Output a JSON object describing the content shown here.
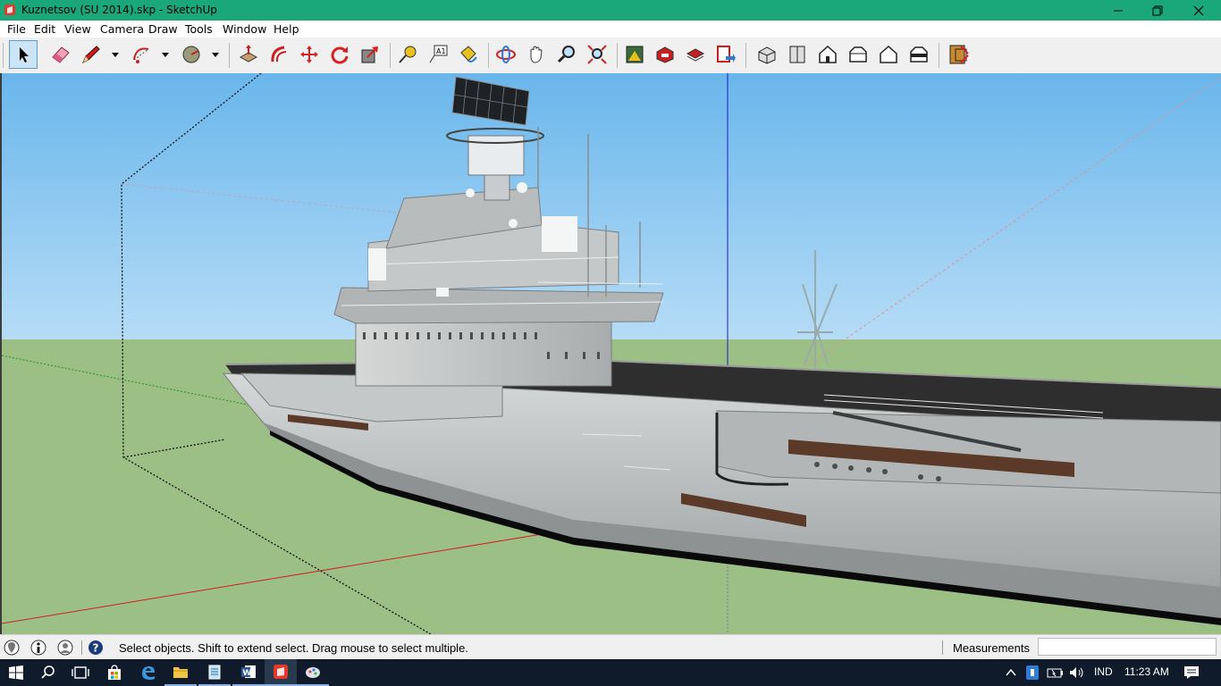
{
  "window": {
    "title": "Kuznetsov (SU 2014).skp - SketchUp",
    "icon": "sketchup-icon",
    "controls": [
      "minimize-icon",
      "restore-icon",
      "close-icon"
    ]
  },
  "menu": {
    "file": "File",
    "edit": "Edit",
    "view": "View",
    "camera": "Camera",
    "draw": "Draw",
    "tools": "Tools",
    "window": "Window",
    "help": "Help"
  },
  "toolbar": {
    "tools": [
      "select-icon",
      "eraser-icon",
      "pencil-icon",
      "arc-icon",
      "circle-icon",
      "push-pull-icon",
      "follow-me-icon",
      "move-icon",
      "rotate-icon",
      "scale-icon",
      "tape-measure-icon",
      "text-icon",
      "paint-bucket-icon",
      "orbit-icon",
      "pan-icon",
      "zoom-icon",
      "zoom-extents-icon",
      "3d-warehouse-icon",
      "extension-warehouse-icon",
      "layout-icon",
      "send-to-layout-icon",
      "iso-view-icon",
      "top-view-icon",
      "front-view-icon",
      "right-view-icon",
      "back-view-icon",
      "left-view-icon",
      "section-plane-icon"
    ],
    "active_tool": "select-icon"
  },
  "viewport": {
    "scene": "aircraft-carrier-3d-model",
    "sky_color": "#7fc4f2",
    "ground_color": "#9cbf86",
    "axes": {
      "red": "#d22020",
      "green": "#1e9a1e",
      "blue": "#1a1ad2"
    }
  },
  "statusbar": {
    "icons": [
      "geo-location-icon",
      "credits-icon",
      "user-icon",
      "help-icon"
    ],
    "message": "Select objects. Shift to extend select. Drag mouse to select multiple.",
    "measurements_label": "Measurements",
    "measurements_value": ""
  },
  "taskbar": {
    "apps": [
      "start-icon",
      "search-icon",
      "task-view-icon",
      "store-icon",
      "edge-icon",
      "file-explorer-icon",
      "notepad-icon",
      "word-icon",
      "sketchup-taskbar-icon",
      "style-builder-icon"
    ],
    "language": "IND",
    "time": "11:23 AM",
    "tray_icons": [
      "show-hidden-icon",
      "onedrive-icon",
      "battery-icon",
      "volume-icon",
      "notification-icon"
    ]
  }
}
